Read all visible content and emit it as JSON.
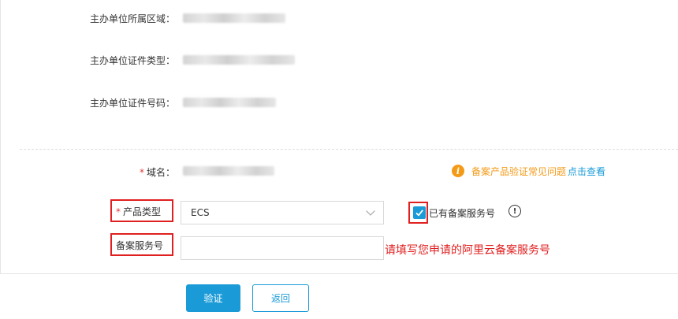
{
  "fields": {
    "region_label": "主办单位所属区域：",
    "cert_type_label": "主办单位证件类型：",
    "cert_no_label": "主办单位证件号码：",
    "domain_label": "域名："
  },
  "required_mark": "*",
  "faq": {
    "icon": "info-icon",
    "text": "备案产品验证常见问题",
    "link": "点击查看"
  },
  "product_type": {
    "label": "产品类型",
    "selected": "ECS"
  },
  "has_service_no": {
    "label": "已有备案服务号",
    "checked": true
  },
  "service_no": {
    "label": "备案服务号",
    "value": "",
    "hint": "请填写您申请的阿里云备案服务号"
  },
  "buttons": {
    "verify": "验证",
    "back": "返回"
  },
  "colors": {
    "accent": "#1a9bd7",
    "warning": "#f39a17",
    "annotation": "#e02020"
  }
}
